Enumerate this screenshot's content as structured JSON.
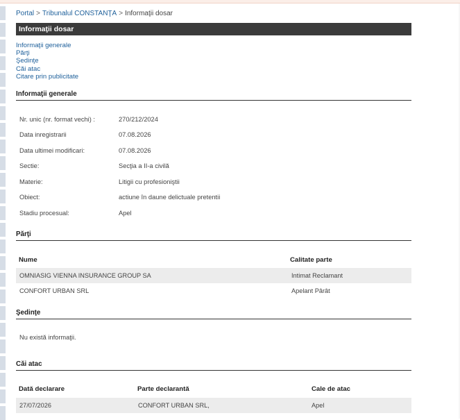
{
  "breadcrumb": {
    "portal": "Portal",
    "court": "Tribunalul CONSTANŢA",
    "current": "Informaţii dosar"
  },
  "page_title": "Informaţii dosar",
  "section_nav": [
    "Informaţii generale",
    "Părţi",
    "Şedinţe",
    "Căi atac",
    "Citare prin publicitate"
  ],
  "general_info": {
    "heading": "Informaţii generale",
    "rows": [
      {
        "label": "Nr. unic (nr. format vechi) :",
        "value": "270/212/2024"
      },
      {
        "label": "Data inregistrarii",
        "value": "07.08.2026"
      },
      {
        "label": "Data ultimei modificari:",
        "value": "07.08.2026"
      },
      {
        "label": "Sectie:",
        "value": "Secţia a II-a civilă"
      },
      {
        "label": "Materie:",
        "value": "Litigii cu profesioniştii"
      },
      {
        "label": "Obiect:",
        "value": "actiune în daune delictuale pretentii"
      },
      {
        "label": "Stadiu procesual:",
        "value": "Apel"
      }
    ]
  },
  "parties": {
    "heading": "Părţi",
    "columns": [
      "Nume",
      "Calitate parte"
    ],
    "rows": [
      {
        "name": "OMNIASIG VIENNA INSURANCE GROUP SA",
        "role": "Intimat Reclamant"
      },
      {
        "name": "CONFORT URBAN SRL",
        "role": "Apelant Pârât"
      }
    ]
  },
  "hearings": {
    "heading": "Şedinţe",
    "empty_message": "Nu există informaţii."
  },
  "appeals": {
    "heading": "Căi atac",
    "columns": [
      "Dată declarare",
      "Parte declarantă",
      "Cale de atac"
    ],
    "rows": [
      {
        "date": "27/07/2026",
        "party": "CONFORT URBAN SRL,",
        "type": "Apel"
      }
    ]
  }
}
